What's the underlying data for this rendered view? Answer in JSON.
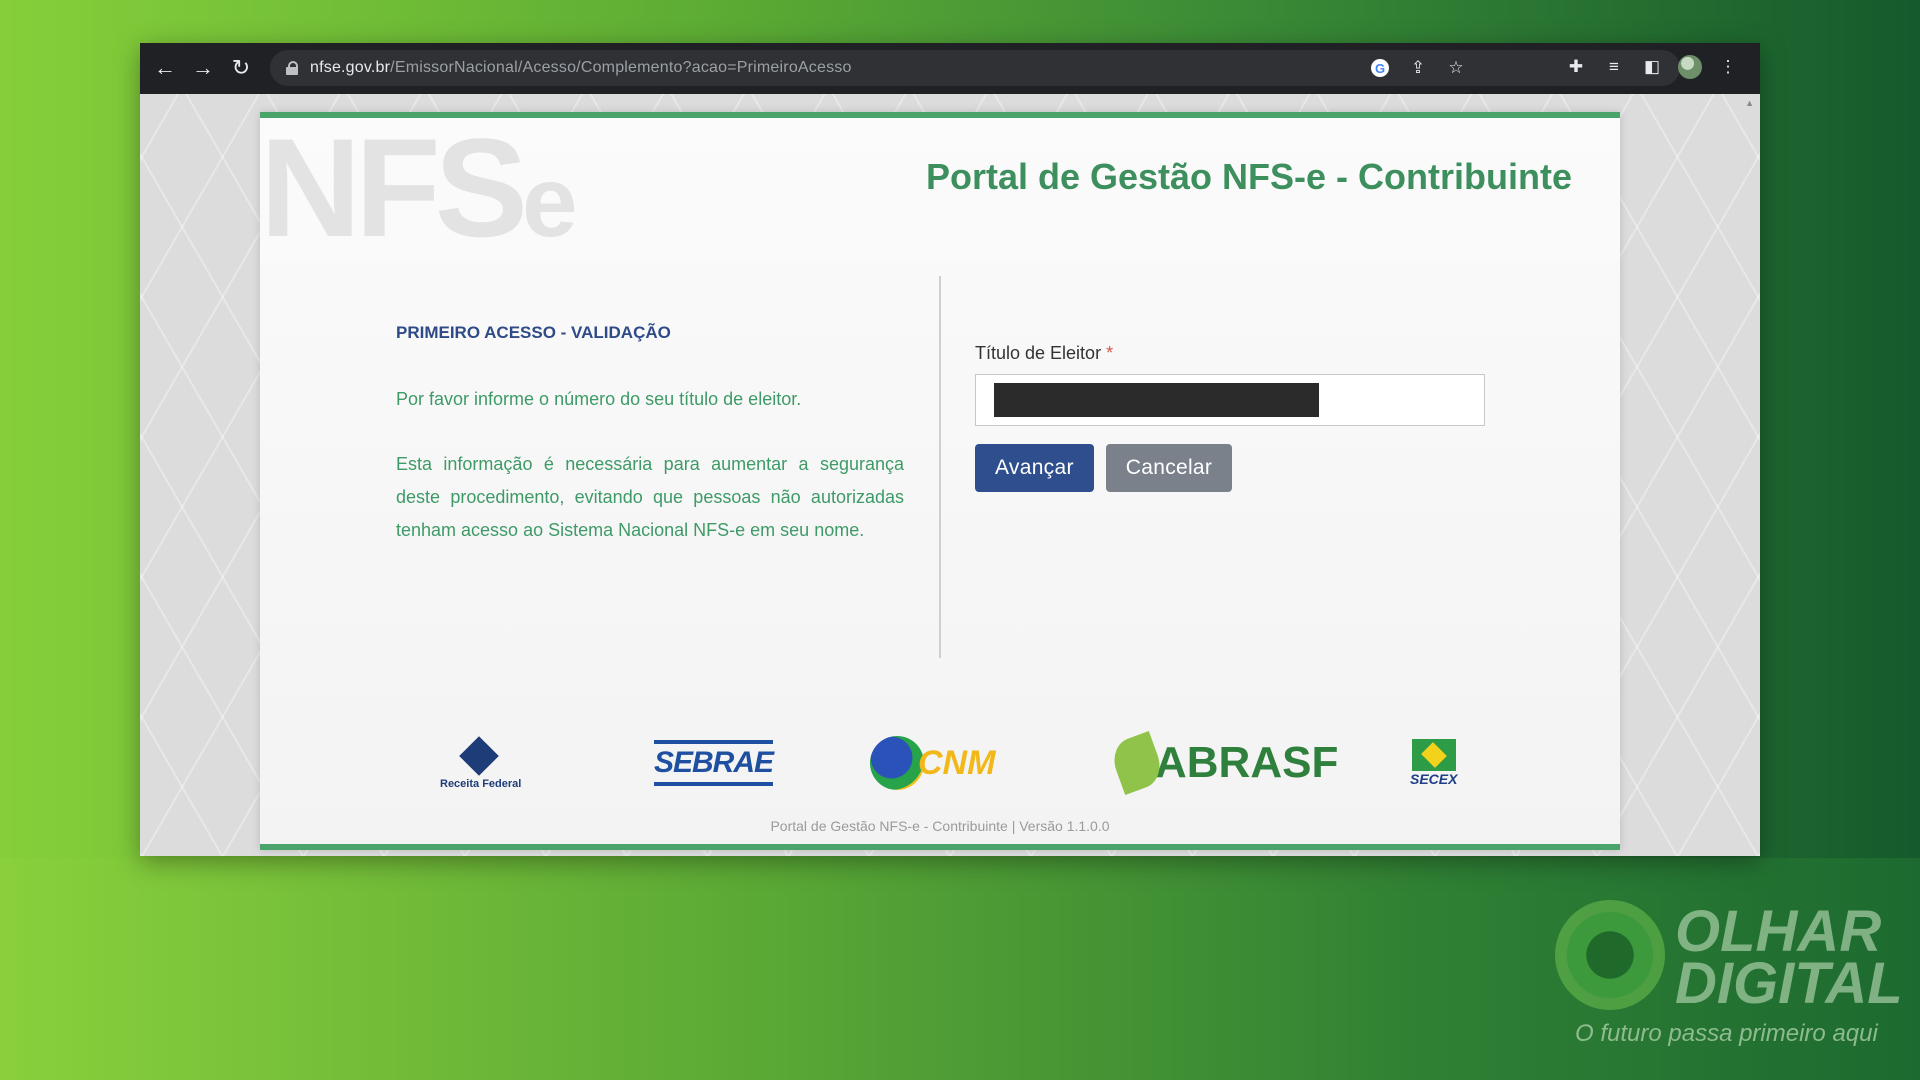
{
  "browser": {
    "url_host": "nfse.gov.br",
    "url_path": "/EmissorNacional/Acesso/Complemento?acao=PrimeiroAcesso",
    "nav_back_icon": "arrow-left-icon",
    "nav_forward_icon": "arrow-right-icon",
    "reload_icon": "reload-icon"
  },
  "page": {
    "watermark": "NFS",
    "watermark_e": "e",
    "portal_title": "Portal de Gestão NFS-e - Contribuinte",
    "section_title": "PRIMEIRO ACESSO - VALIDAÇÃO",
    "paragraph_1": "Por favor informe o número do seu título de eleitor.",
    "paragraph_2": "Esta informação é necessária para aumentar a segurança deste procedimento, evitando que pessoas não autorizadas tenham acesso ao Sistema Nacional NFS-e em seu nome.",
    "field_label": "Título de Eleitor",
    "required_mark": "*",
    "field_value": "",
    "primary_button": "Avançar",
    "secondary_button": "Cancelar",
    "footer": "Portal de Gestão NFS-e - Contribuinte | Versão 1.1.0.0"
  },
  "logos": {
    "receita": "Receita Federal",
    "sebrae": "SEBRAE",
    "cnm": "CNM",
    "abrasf": "ABRASF",
    "secex": "SECEX"
  },
  "brand": {
    "name": "OLHAR DIGITAL",
    "tagline": "O futuro passa primeiro aqui"
  },
  "colors": {
    "accent_green": "#4aa36b",
    "title_green": "#3d8f5e",
    "primary_blue": "#2f4e8d",
    "secondary_gray": "#7a818b"
  }
}
